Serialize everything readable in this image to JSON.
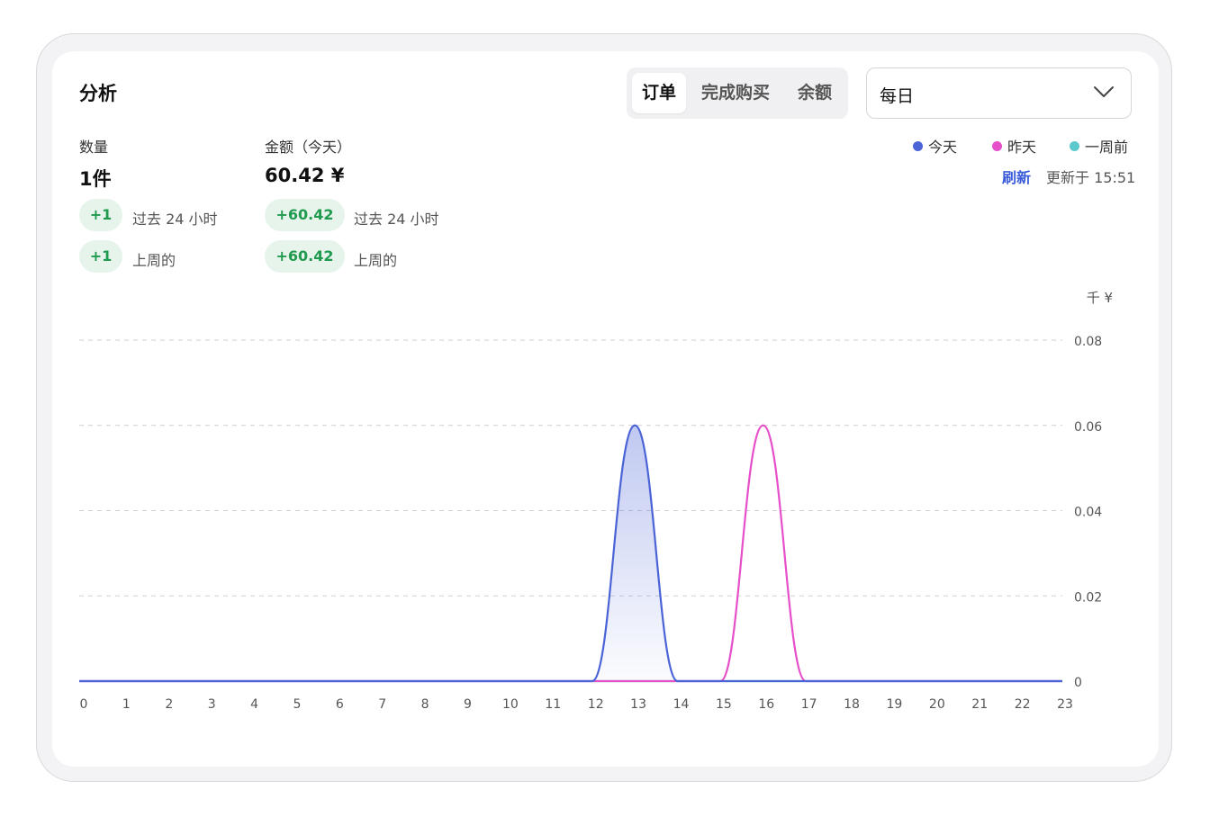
{
  "card": {
    "title": "分析"
  },
  "tabs": [
    {
      "label": "订单",
      "active": true
    },
    {
      "label": "完成购买",
      "active": false
    },
    {
      "label": "余额",
      "active": false
    }
  ],
  "period_select": {
    "value": "每日"
  },
  "stats": {
    "quantity": {
      "label": "数量",
      "value": "1件",
      "changes": [
        {
          "delta": "+1",
          "text": "过去 24 小时"
        },
        {
          "delta": "+1",
          "text": "上周的"
        }
      ]
    },
    "amount": {
      "label": "金额（今天）",
      "value": "60.42 ¥",
      "changes": [
        {
          "delta": "+60.42",
          "text": "过去 24 小时"
        },
        {
          "delta": "+60.42",
          "text": "上周的"
        }
      ]
    }
  },
  "legend": [
    {
      "label": "今天",
      "color": "#4a63d6"
    },
    {
      "label": "昨天",
      "color": "#e64fc9"
    },
    {
      "label": "一周前",
      "color": "#5cc9cc"
    }
  ],
  "refresh_label": "刷新",
  "updated_text": "更新于 15:51",
  "chart_data": {
    "type": "area",
    "unit_label": "千 ¥",
    "x": [
      0,
      1,
      2,
      3,
      4,
      5,
      6,
      7,
      8,
      9,
      10,
      11,
      12,
      13,
      14,
      15,
      16,
      17,
      18,
      19,
      20,
      21,
      22,
      23
    ],
    "ylim": [
      0,
      0.08
    ],
    "yticks": [
      "0",
      "0.02",
      "0.04",
      "0.06",
      "0.08"
    ],
    "grid": true,
    "series": [
      {
        "name": "今天",
        "color": "#4a63d6",
        "filled": true,
        "values": [
          0,
          0,
          0,
          0,
          0,
          0,
          0,
          0,
          0,
          0,
          0,
          0,
          0,
          0.06,
          0,
          0,
          0,
          0,
          0,
          0,
          0,
          0,
          0,
          0
        ]
      },
      {
        "name": "昨天",
        "color": "#e64fc9",
        "filled": false,
        "values": [
          0,
          0,
          0,
          0,
          0,
          0,
          0,
          0,
          0,
          0,
          0,
          0,
          0,
          0,
          0,
          0,
          0.06,
          0,
          0,
          0,
          0,
          0,
          0,
          0
        ]
      },
      {
        "name": "一周前",
        "color": "#5cc9cc",
        "filled": false,
        "values": [
          0,
          0,
          0,
          0,
          0,
          0,
          0,
          0,
          0,
          0,
          0,
          0,
          0,
          0,
          0,
          0,
          0,
          0,
          0,
          0,
          0,
          0,
          0,
          0
        ]
      }
    ]
  }
}
